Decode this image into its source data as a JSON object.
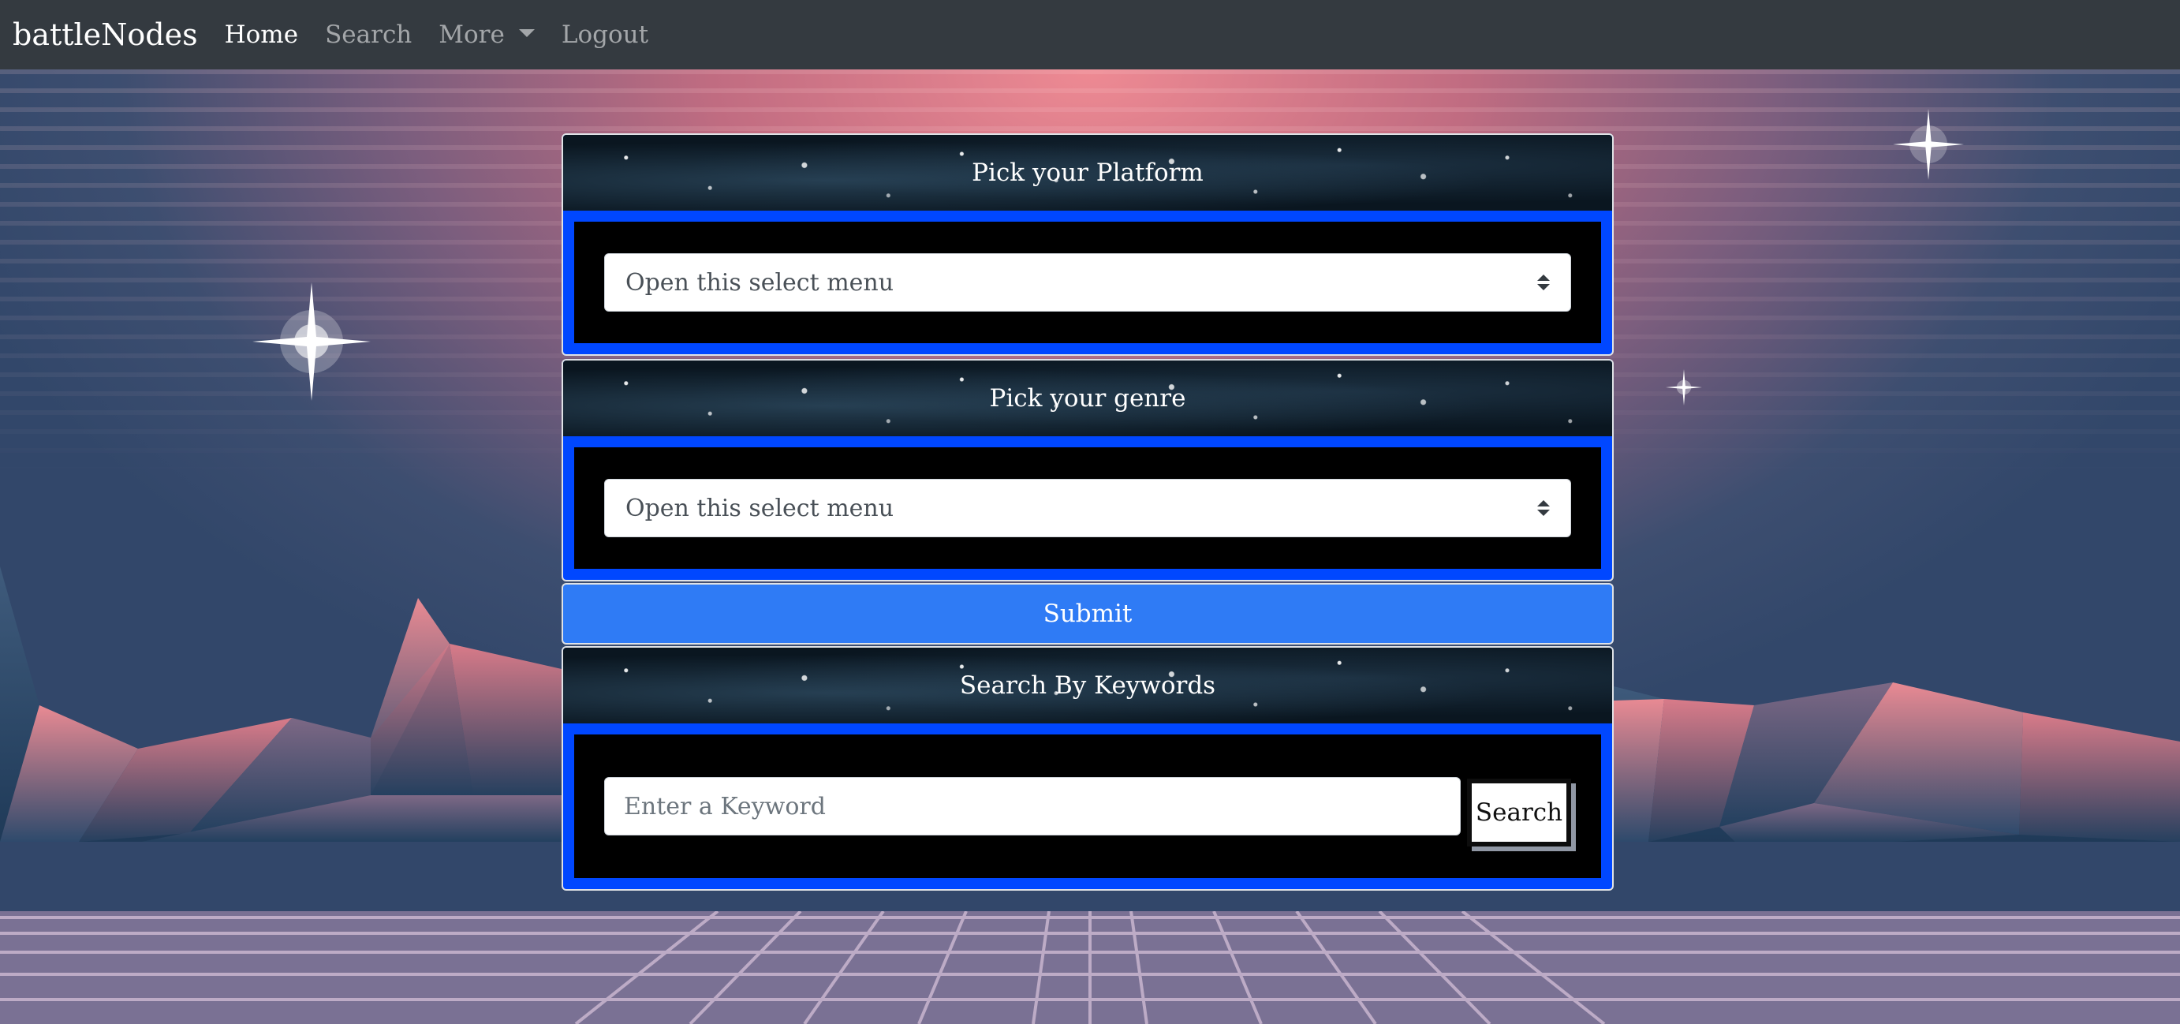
{
  "navbar": {
    "brand": "battleNodes",
    "links": [
      {
        "label": "Home",
        "active": true
      },
      {
        "label": "Search",
        "active": false
      },
      {
        "label": "More",
        "active": false,
        "dropdown": true
      },
      {
        "label": "Logout",
        "active": false
      }
    ]
  },
  "platform_section": {
    "title": "Pick your Platform",
    "select_value": "Open this select menu"
  },
  "genre_section": {
    "title": "Pick your genre",
    "select_value": "Open this select menu"
  },
  "submit_label": "Submit",
  "keyword_section": {
    "title": "Search By Keywords",
    "input_placeholder": "Enter a Keyword",
    "search_label": "Search"
  },
  "colors": {
    "navbar": "#343a40",
    "card_frame": "#0047ff",
    "submit": "#2f7bf5"
  }
}
